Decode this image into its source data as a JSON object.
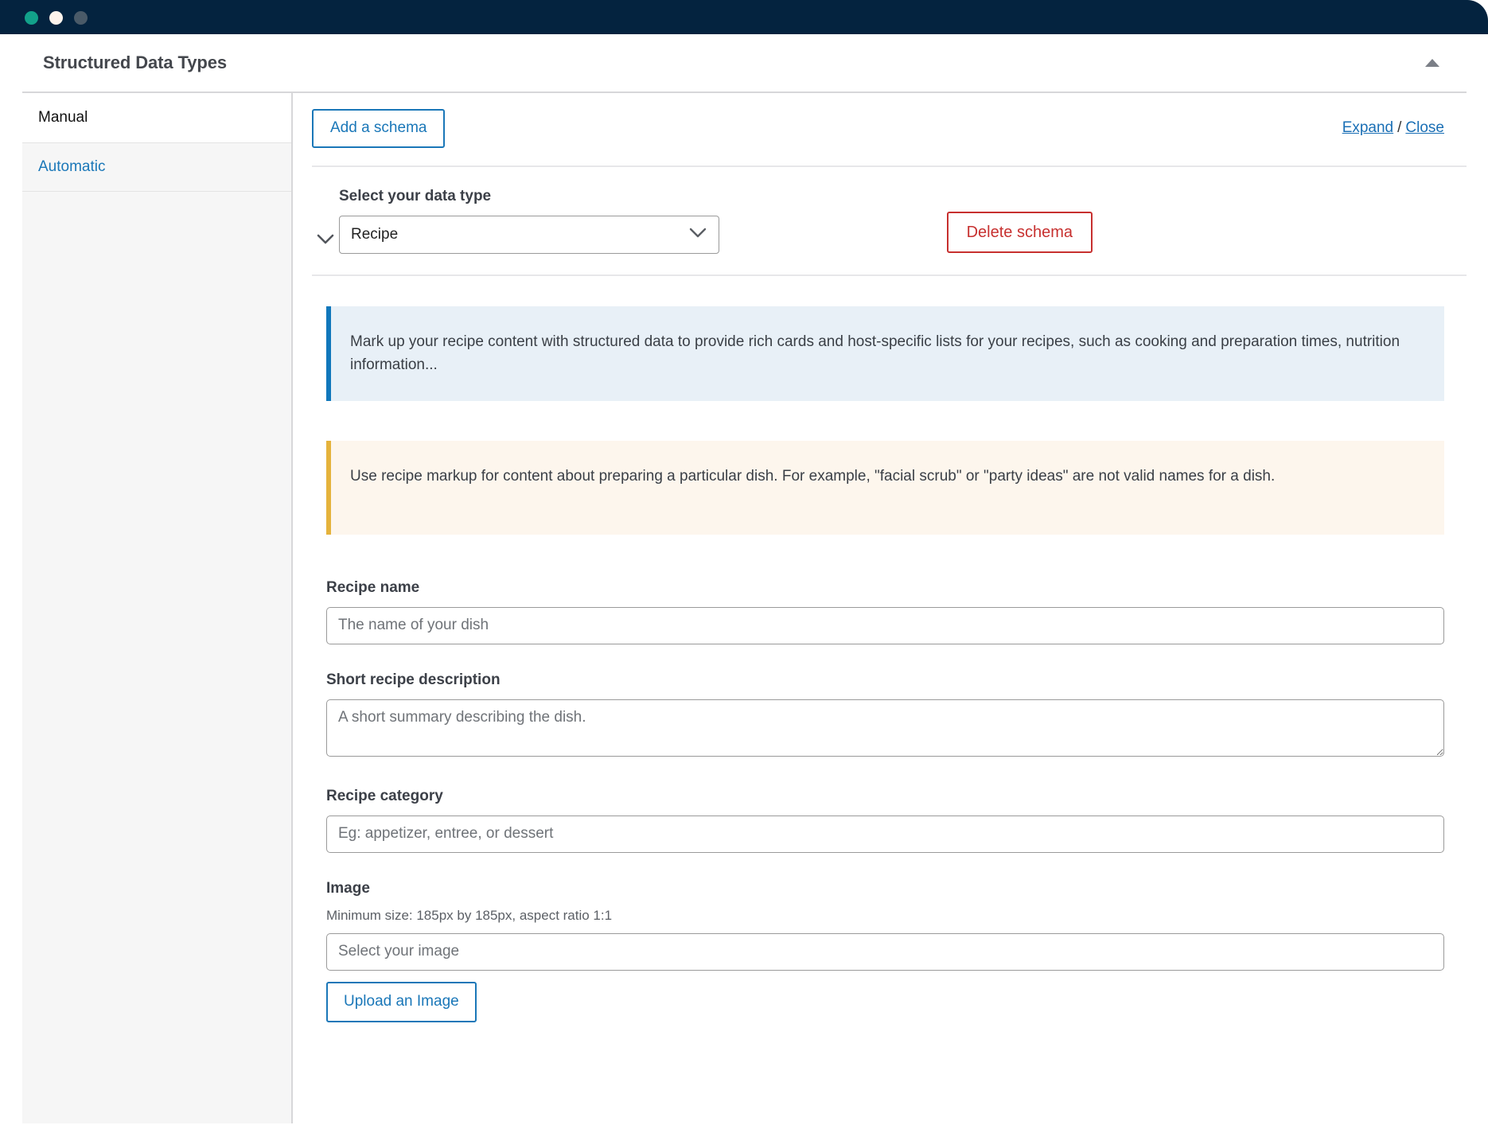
{
  "window": {
    "traffic_lights": [
      "green",
      "yellow",
      "gray"
    ]
  },
  "panel": {
    "title": "Structured Data Types",
    "collapse_icon": "caret-up-icon"
  },
  "sidebar": {
    "items": [
      {
        "label": "Manual",
        "state": "active"
      },
      {
        "label": "Automatic",
        "state": "link"
      }
    ]
  },
  "toolbar": {
    "add_schema_label": "Add a schema",
    "expand_label": "Expand",
    "separator": "/",
    "close_label": "Close"
  },
  "schema": {
    "toggle_icon": "chevron-down-icon",
    "data_type_label": "Select your data type",
    "data_type_value": "Recipe",
    "data_type_caret_icon": "chevron-down-icon",
    "delete_label": "Delete schema"
  },
  "notices": {
    "info": "Mark up your recipe content with structured data to provide rich cards and host-specific lists for your recipes, such as cooking and preparation times, nutrition information...",
    "warning": "Use recipe markup for content about preparing a particular dish. For example, \"facial scrub\" or \"party ideas\" are not valid names for a dish."
  },
  "form": {
    "recipe_name": {
      "label": "Recipe name",
      "placeholder": "The name of your dish",
      "value": ""
    },
    "short_description": {
      "label": "Short recipe description",
      "placeholder": "A short summary describing the dish.",
      "value": ""
    },
    "recipe_category": {
      "label": "Recipe category",
      "placeholder": "Eg: appetizer, entree, or dessert",
      "value": ""
    },
    "image": {
      "label": "Image",
      "help": "Minimum size: 185px by 185px, aspect ratio 1:1",
      "placeholder": "Select your image",
      "value": "",
      "upload_label": "Upload an Image"
    }
  },
  "colors": {
    "titlebar": "#04233f",
    "accent_blue": "#1a77b8",
    "danger_red": "#c7302f",
    "info_bg": "#e8f0f7",
    "info_border": "#1077bb",
    "warn_bg": "#fdf6ed",
    "warn_border": "#e5b33c",
    "sidebar_bg": "#f6f6f6"
  }
}
